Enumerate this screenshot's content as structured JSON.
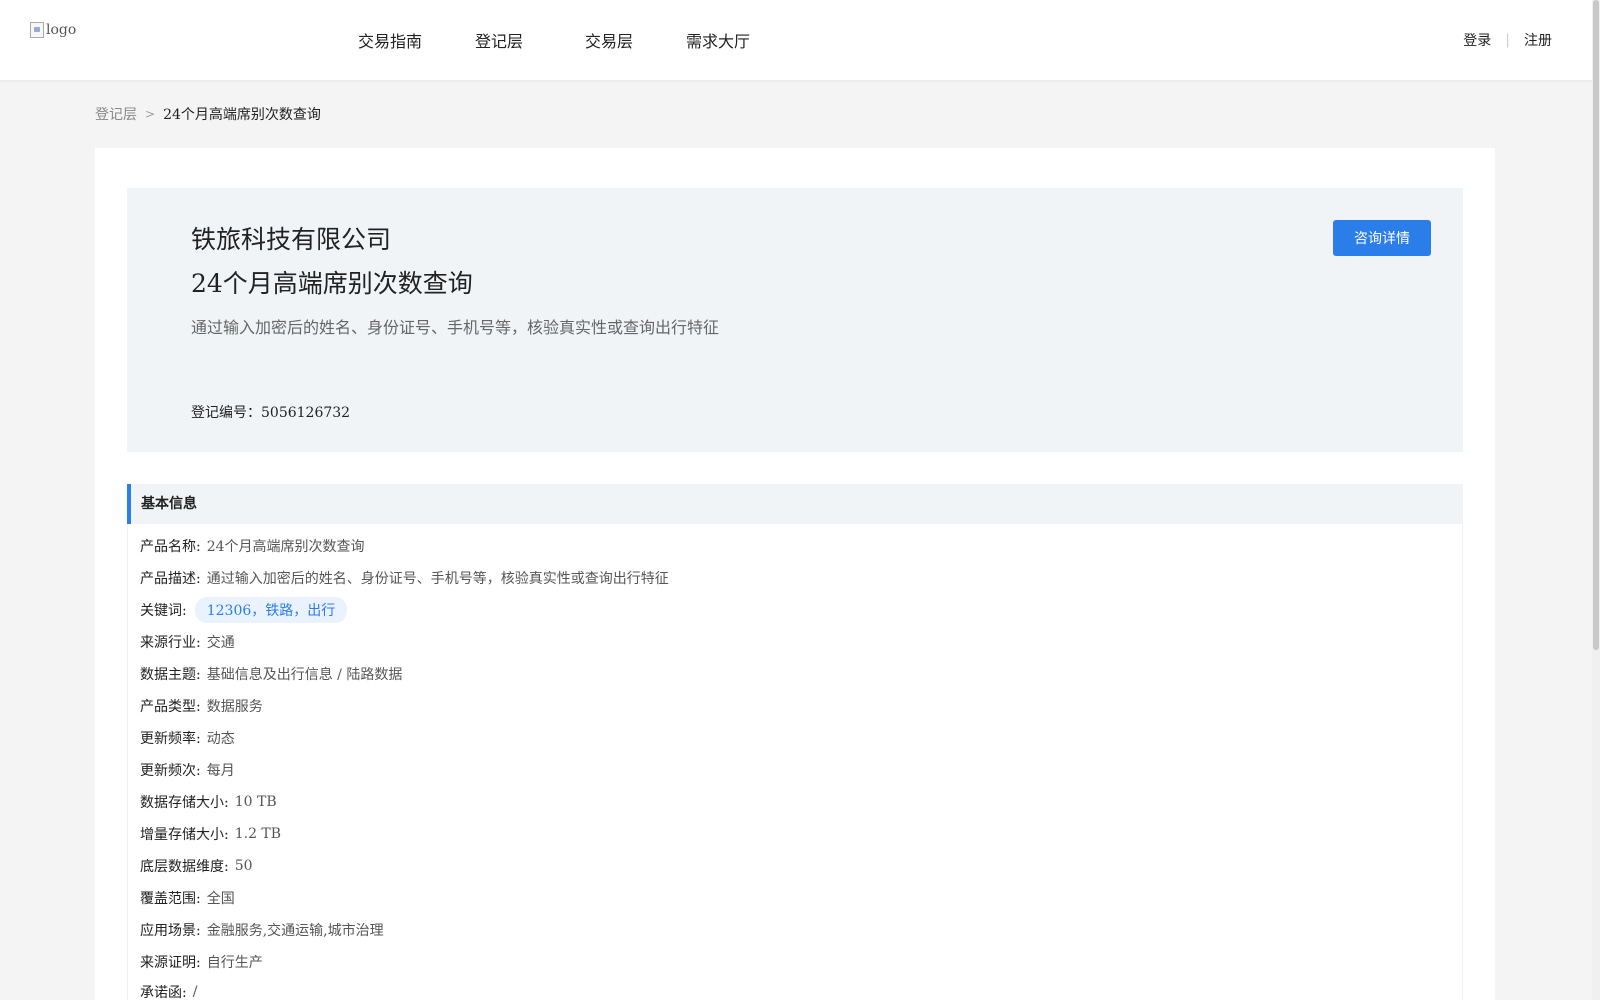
{
  "header": {
    "logo_alt": "logo",
    "nav": [
      "交易指南",
      "登记层",
      "交易层",
      "需求大厅"
    ],
    "login": "登录",
    "register": "注册"
  },
  "breadcrumb": {
    "parent": "登记层",
    "current": "24个月高端席别次数查询"
  },
  "hero": {
    "company": "铁旅科技有限公司",
    "product": "24个月高端席别次数查询",
    "description": "通过输入加密后的姓名、身份证号、手机号等，核验真实性或查询出行特征",
    "reg_label": "登记编号：",
    "reg_number": "5056126732",
    "consult_button": "咨询详情"
  },
  "basic_info": {
    "title": "基本信息",
    "rows": [
      {
        "label": "产品名称:",
        "value": "24个月高端席别次数查询"
      },
      {
        "label": "产品描述:",
        "value": "通过输入加密后的姓名、身份证号、手机号等，核验真实性或查询出行特征"
      },
      {
        "label": "关键词:",
        "value": "12306，铁路，出行"
      },
      {
        "label": "来源行业:",
        "value": "交通"
      },
      {
        "label": "数据主题:",
        "value": "基础信息及出行信息 / 陆路数据"
      },
      {
        "label": "产品类型:",
        "value": "数据服务"
      },
      {
        "label": "更新频率:",
        "value": "动态"
      },
      {
        "label": "更新频次:",
        "value": "每月"
      },
      {
        "label": "数据存储大小:",
        "value": "10 TB"
      },
      {
        "label": "增量存储大小:",
        "value": "1.2 TB"
      },
      {
        "label": "底层数据维度:",
        "value": "50"
      },
      {
        "label": "覆盖范围:",
        "value": "全国"
      },
      {
        "label": "应用场景:",
        "value": "金融服务,交通运输,城市治理"
      },
      {
        "label": "来源证明:",
        "value": "自行生产"
      },
      {
        "label": "承诺函:",
        "value": "/"
      }
    ]
  },
  "colors": {
    "accent": "#2b7de9",
    "hero_bg": "#f1f4f7",
    "page_bg": "#f4f4f4"
  }
}
